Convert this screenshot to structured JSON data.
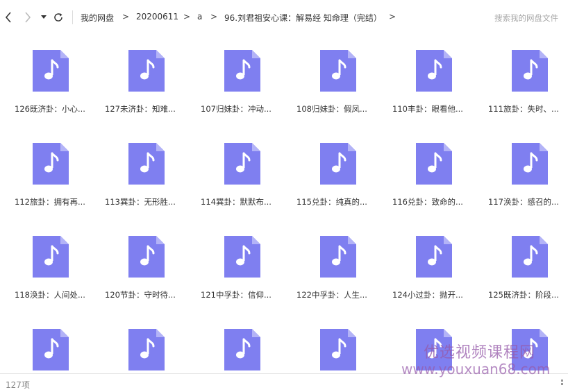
{
  "toolbar": {
    "back_icon": "chevron-left-icon",
    "forward_icon": "chevron-right-icon",
    "dropdown_icon": "caret-down-icon",
    "refresh_icon": "refresh-icon",
    "breadcrumb": [
      "我的网盘",
      "20200611",
      "a",
      "96.刘君祖安心课：解易经 知命理（完结）"
    ],
    "separator": ">",
    "search_placeholder": "搜索我的网盘文件"
  },
  "files": [
    {
      "name": "126既济卦：小心..."
    },
    {
      "name": "127未济卦：知难..."
    },
    {
      "name": "107归妹卦：冲动..."
    },
    {
      "name": "108归妹卦：假凤..."
    },
    {
      "name": "110丰卦：眼看他..."
    },
    {
      "name": "111旅卦：失时、..."
    },
    {
      "name": "112旅卦：拥有再..."
    },
    {
      "name": "113巽卦：无形胜..."
    },
    {
      "name": "114巽卦：默默布..."
    },
    {
      "name": "115兑卦：纯真的..."
    },
    {
      "name": "116兑卦：致命的..."
    },
    {
      "name": "117涣卦：感召的..."
    },
    {
      "name": "118涣卦：人间处..."
    },
    {
      "name": "120节卦：守时待..."
    },
    {
      "name": "121中孚卦：信仰..."
    },
    {
      "name": "122中孚卦：人生..."
    },
    {
      "name": "124小过卦：抛开..."
    },
    {
      "name": "125既济卦：阶段..."
    },
    {
      "name": ""
    },
    {
      "name": ""
    },
    {
      "name": ""
    },
    {
      "name": ""
    },
    {
      "name": ""
    },
    {
      "name": ""
    }
  ],
  "file_icon": "music-note-file-icon",
  "colors": {
    "file_icon": "#7f7ff0",
    "file_icon_fold": "#b3b3f7",
    "watermark": "#9a5fae"
  },
  "status": {
    "count": "127项"
  },
  "watermark": {
    "line1": "优选视频课程网",
    "line2": "www.youxuan68.com"
  }
}
